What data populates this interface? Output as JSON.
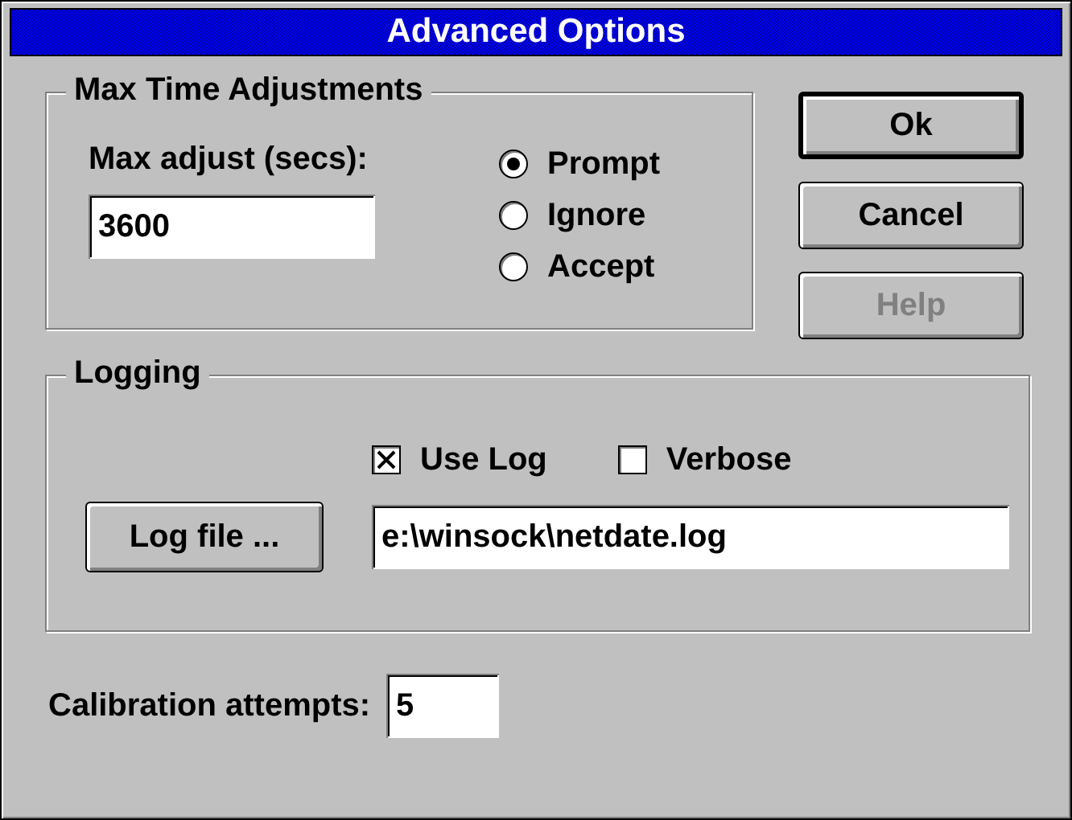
{
  "window": {
    "title": "Advanced Options"
  },
  "max_time_adjustments": {
    "title": "Max Time Adjustments",
    "max_adjust": {
      "label": "Max adjust (secs):",
      "value": "3600"
    },
    "options": [
      {
        "label": "Prompt",
        "selected": true
      },
      {
        "label": "Ignore",
        "selected": false
      },
      {
        "label": "Accept",
        "selected": false
      }
    ]
  },
  "buttons": [
    {
      "label": "Ok",
      "default": true,
      "disabled": false
    },
    {
      "label": "Cancel",
      "default": false,
      "disabled": false
    },
    {
      "label": "Help",
      "default": false,
      "disabled": true
    }
  ],
  "logging": {
    "title": "Logging",
    "options": [
      {
        "label": "Use Log",
        "checked": true
      },
      {
        "label": "Verbose",
        "checked": false
      }
    ],
    "log_file_button": "Log file ...",
    "log_file": {
      "value": "e:\\winsock\\netdate.log"
    }
  },
  "calibration": {
    "label": "Calibration attempts:",
    "value": "5"
  }
}
